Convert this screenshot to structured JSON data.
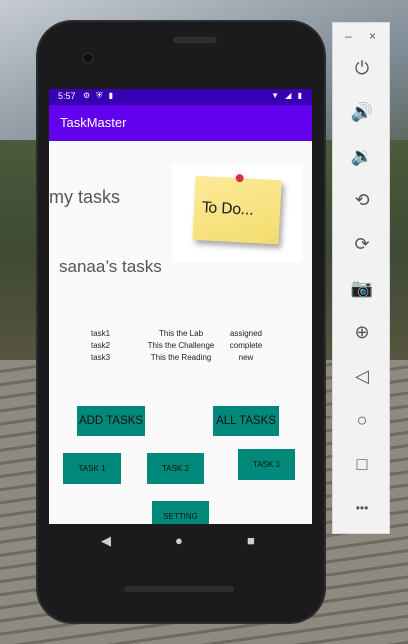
{
  "status_bar": {
    "time": "5:57",
    "left_icons": "⚙ ⛨ ▮",
    "right_icons": "▼ ◢ ▮"
  },
  "app_bar": {
    "title": "TaskMaster"
  },
  "main": {
    "my_tasks_label": "my tasks",
    "user_tasks_label": "sanaa’s tasks",
    "todo_note_text": "To Do...",
    "tasks": [
      {
        "name": "task1",
        "description": "This the Lab",
        "state": "assigned"
      },
      {
        "name": "task2",
        "description": "This the Challenge",
        "state": "complete"
      },
      {
        "name": "task3",
        "description": "This the Reading",
        "state": "new"
      }
    ],
    "buttons": {
      "add_tasks": "ADD TASKS",
      "all_tasks": "ALL TASKS",
      "task1": "TASK 1",
      "task2": "TASK 2",
      "task3": "TASK 3",
      "setting": "SETTING"
    }
  },
  "nav_bar": {
    "back": "◀",
    "home": "●",
    "recent": "■"
  },
  "emulator_panel": {
    "minimize": "–",
    "close": "×",
    "icons": [
      "power-icon",
      "volume-up-icon",
      "volume-down-icon",
      "rotate-left-icon",
      "rotate-right-icon",
      "camera-icon",
      "zoom-icon",
      "back-icon",
      "home-icon",
      "overview-icon",
      "more-icon"
    ],
    "glyphs": {
      "power": "⏻",
      "volume_up": "🔊",
      "volume_down": "🔉",
      "rotate_left": "⟲",
      "rotate_right": "⟳",
      "camera": "📷",
      "zoom": "⊕",
      "back": "◁",
      "home": "○",
      "overview": "□",
      "more": "•••"
    }
  },
  "colors": {
    "status_bar": "#3700b3",
    "app_bar": "#6200ee",
    "button": "#00897b"
  }
}
